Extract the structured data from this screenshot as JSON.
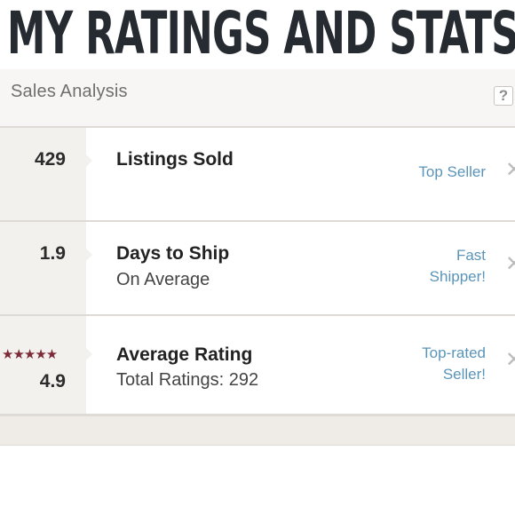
{
  "banner": {
    "text": "MY RATINGS AND STATS"
  },
  "panel": {
    "title": "Sales Analysis",
    "help_label": "?"
  },
  "rows": [
    {
      "value": "429",
      "title": "Listings Sold",
      "subtitle": "",
      "badge_line1": "Top Seller",
      "badge_line2": ""
    },
    {
      "value": "1.9",
      "title": "Days to Ship",
      "subtitle": "On Average",
      "badge_line1": "Fast",
      "badge_line2": "Shipper!"
    },
    {
      "value": "4.9",
      "title": "Average Rating",
      "subtitle": "Total Ratings: 292",
      "badge_line1": "Top-rated",
      "badge_line2": "Seller!",
      "stars": "★★★★★",
      "rating_stars": 5
    }
  ],
  "colors": {
    "accent": "#5a94b8",
    "stars": "#7b2a36",
    "banner_text": "#252b31"
  }
}
